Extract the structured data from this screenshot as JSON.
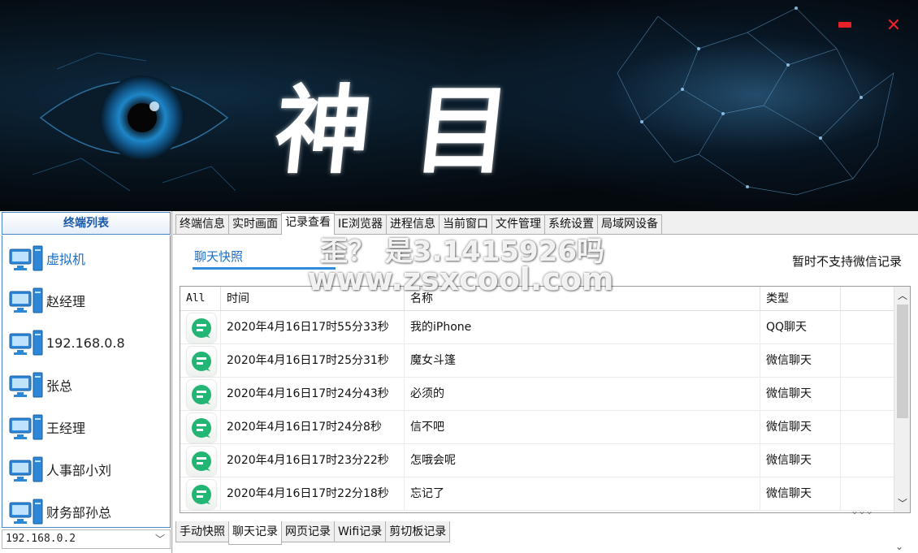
{
  "banner": {
    "title": "神 目",
    "minimize_label": "",
    "close_label": "✕"
  },
  "terminals": {
    "header": "终端列表",
    "items": [
      {
        "label": "虚拟机",
        "selected": true
      },
      {
        "label": "赵经理",
        "selected": false
      },
      {
        "label": "192.168.0.8",
        "selected": false
      },
      {
        "label": "张总",
        "selected": false
      },
      {
        "label": "王经理",
        "selected": false
      },
      {
        "label": "人事部小刘",
        "selected": false
      },
      {
        "label": "财务部孙总",
        "selected": false
      }
    ],
    "ip_select": "192.168.0.2"
  },
  "tabs": [
    {
      "label": "终端信息"
    },
    {
      "label": "实时画面"
    },
    {
      "label": "记录查看",
      "active": true
    },
    {
      "label": "IE浏览器"
    },
    {
      "label": "进程信息"
    },
    {
      "label": "当前窗口"
    },
    {
      "label": "文件管理"
    },
    {
      "label": "系统设置"
    },
    {
      "label": "局域网设备"
    }
  ],
  "content": {
    "subtab": "聊天快照",
    "notice": "暂时不支持微信记录"
  },
  "table": {
    "headers": {
      "all": "All",
      "time": "时间",
      "name": "名称",
      "type": "类型"
    },
    "rows": [
      {
        "time": "2020年4月16日17时55分33秒",
        "name": "我的iPhone",
        "type": "QQ聊天"
      },
      {
        "time": "2020年4月16日17时25分31秒",
        "name": "魔女斗篷",
        "type": "微信聊天"
      },
      {
        "time": "2020年4月16日17时24分43秒",
        "name": "必须的",
        "type": "微信聊天"
      },
      {
        "time": "2020年4月16日17时24分8秒",
        "name": "信不吧",
        "type": "微信聊天"
      },
      {
        "time": "2020年4月16日17时23分22秒",
        "name": "怎哦会呢",
        "type": "微信聊天"
      },
      {
        "time": "2020年4月16日17时22分18秒",
        "name": "忘记了",
        "type": "微信聊天"
      }
    ]
  },
  "bottom_tabs": [
    {
      "label": "手动快照"
    },
    {
      "label": "聊天记录",
      "active": true
    },
    {
      "label": "网页记录"
    },
    {
      "label": "Wifi记录"
    },
    {
      "label": "剪切板记录"
    }
  ],
  "watermark": {
    "line1": "歪？ 是3.1415926吗",
    "line2": "www.zsxcool.com"
  },
  "colors": {
    "accent": "#2f8be0",
    "chat_icon": "#22b573",
    "window_controls": "#e8202a"
  }
}
